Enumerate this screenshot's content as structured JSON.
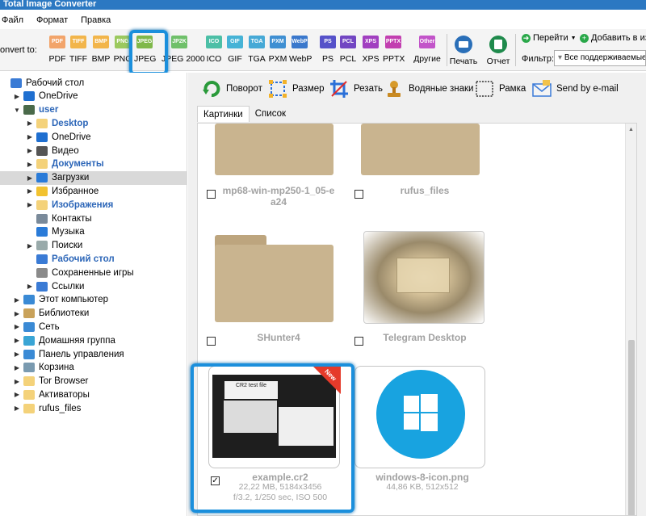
{
  "app": {
    "title": "Total Image Converter"
  },
  "menu": [
    "Файл",
    "Формат",
    "Правка"
  ],
  "toolbar": {
    "convert_label": "onvert to:",
    "formats": [
      {
        "badge": "PDF",
        "label": "PDF",
        "color": "#f2a46a"
      },
      {
        "badge": "TIFF",
        "label": "TIFF",
        "color": "#f2b54a"
      },
      {
        "badge": "BMP",
        "label": "BMP",
        "color": "#f2b54a"
      },
      {
        "badge": "PNG",
        "label": "PNG",
        "color": "#9bc95e"
      },
      {
        "badge": "JPEG",
        "label": "JPEG",
        "color": "#7fb84a"
      },
      {
        "badge": "JP2K",
        "label": "JPEG 2000",
        "color": "#6fc06a"
      },
      {
        "badge": "ICO",
        "label": "ICO",
        "color": "#4cbfa6"
      },
      {
        "badge": "GIF",
        "label": "GIF",
        "color": "#46b3d6"
      },
      {
        "badge": "TGA",
        "label": "TGA",
        "color": "#46a9d6"
      },
      {
        "badge": "PXM",
        "label": "PXM",
        "color": "#3f8fd2"
      },
      {
        "badge": "WebP",
        "label": "WebP",
        "color": "#3a78cc"
      },
      {
        "badge": "PS",
        "label": "PS",
        "color": "#5551c9"
      },
      {
        "badge": "PCL",
        "label": "PCL",
        "color": "#7246c2"
      },
      {
        "badge": "XPS",
        "label": "XPS",
        "color": "#a13fc0"
      },
      {
        "badge": "PPTX",
        "label": "PPTX",
        "color": "#c23fb0"
      },
      {
        "badge": "Other",
        "label": "Другие",
        "color": "#c254c9"
      }
    ],
    "print_label": "Печать",
    "report_label": "Отчет",
    "goto_label": "Перейти",
    "add_fav_label": "Добавить в избра",
    "filter_label": "Фильтр:",
    "filter_value": "Все поддерживаемые"
  },
  "tree": [
    {
      "label": "Рабочий стол",
      "indent": 0,
      "icon": "desktop-icon",
      "arrow": "",
      "bold": false,
      "selected": false,
      "icolor": "#3a7bd5"
    },
    {
      "label": "OneDrive",
      "indent": 1,
      "icon": "onedrive-icon",
      "arrow": "▶",
      "bold": false,
      "selected": false,
      "icolor": "#1f6fd0"
    },
    {
      "label": "user",
      "indent": 1,
      "icon": "user-icon",
      "arrow": "▼",
      "bold": true,
      "selected": false,
      "icolor": "#4a6a4a"
    },
    {
      "label": "Desktop",
      "indent": 2,
      "icon": "folder-icon",
      "arrow": "▶",
      "bold": true,
      "selected": false,
      "icolor": "#f4d27a"
    },
    {
      "label": "OneDrive",
      "indent": 2,
      "icon": "onedrive-icon",
      "arrow": "▶",
      "bold": false,
      "selected": false,
      "icolor": "#1f6fd0"
    },
    {
      "label": "Видео",
      "indent": 2,
      "icon": "video-icon",
      "arrow": "▶",
      "bold": false,
      "selected": false,
      "icolor": "#555"
    },
    {
      "label": "Документы",
      "indent": 2,
      "icon": "documents-icon",
      "arrow": "▶",
      "bold": true,
      "selected": false,
      "icolor": "#f4d27a"
    },
    {
      "label": "Загрузки",
      "indent": 2,
      "icon": "downloads-icon",
      "arrow": "▶",
      "bold": false,
      "selected": true,
      "icolor": "#2a7bd8"
    },
    {
      "label": "Избранное",
      "indent": 2,
      "icon": "star-icon",
      "arrow": "▶",
      "bold": false,
      "selected": false,
      "icolor": "#f2c230"
    },
    {
      "label": "Изображения",
      "indent": 2,
      "icon": "images-icon",
      "arrow": "▶",
      "bold": true,
      "selected": false,
      "icolor": "#f4d27a"
    },
    {
      "label": "Контакты",
      "indent": 2,
      "icon": "contacts-icon",
      "arrow": "",
      "bold": false,
      "selected": false,
      "icolor": "#7a8a9a"
    },
    {
      "label": "Музыка",
      "indent": 2,
      "icon": "music-icon",
      "arrow": "",
      "bold": false,
      "selected": false,
      "icolor": "#2a7bd8"
    },
    {
      "label": "Поиски",
      "indent": 2,
      "icon": "search-icon",
      "arrow": "▶",
      "bold": false,
      "selected": false,
      "icolor": "#9aa"
    },
    {
      "label": "Рабочий стол",
      "indent": 2,
      "icon": "desktop-icon",
      "arrow": "",
      "bold": true,
      "selected": false,
      "icolor": "#3a7bd5"
    },
    {
      "label": "Сохраненные игры",
      "indent": 2,
      "icon": "games-icon",
      "arrow": "",
      "bold": false,
      "selected": false,
      "icolor": "#8a8a8a"
    },
    {
      "label": "Ссылки",
      "indent": 2,
      "icon": "links-icon",
      "arrow": "▶",
      "bold": false,
      "selected": false,
      "icolor": "#3a7bd5"
    },
    {
      "label": "Этот компьютер",
      "indent": 1,
      "icon": "computer-icon",
      "arrow": "▶",
      "bold": false,
      "selected": false,
      "icolor": "#3a8ad5"
    },
    {
      "label": "Библиотеки",
      "indent": 1,
      "icon": "libraries-icon",
      "arrow": "▶",
      "bold": false,
      "selected": false,
      "icolor": "#c9a25a"
    },
    {
      "label": "Сеть",
      "indent": 1,
      "icon": "network-icon",
      "arrow": "▶",
      "bold": false,
      "selected": false,
      "icolor": "#3a8ad5"
    },
    {
      "label": "Домашняя группа",
      "indent": 1,
      "icon": "homegroup-icon",
      "arrow": "▶",
      "bold": false,
      "selected": false,
      "icolor": "#3aa5d5"
    },
    {
      "label": "Панель управления",
      "indent": 1,
      "icon": "control-panel-icon",
      "arrow": "▶",
      "bold": false,
      "selected": false,
      "icolor": "#3a8ad5"
    },
    {
      "label": "Корзина",
      "indent": 1,
      "icon": "recycle-bin-icon",
      "arrow": "▶",
      "bold": false,
      "selected": false,
      "icolor": "#7a9ab0"
    },
    {
      "label": "Tor Browser",
      "indent": 1,
      "icon": "folder-icon",
      "arrow": "▶",
      "bold": false,
      "selected": false,
      "icolor": "#f4d27a"
    },
    {
      "label": "Активаторы",
      "indent": 1,
      "icon": "folder-icon",
      "arrow": "▶",
      "bold": false,
      "selected": false,
      "icolor": "#f4d27a"
    },
    {
      "label": "rufus_files",
      "indent": 1,
      "icon": "folder-icon",
      "arrow": "▶",
      "bold": false,
      "selected": false,
      "icolor": "#f4d27a"
    }
  ],
  "content_toolbar": {
    "rotate": "Поворот",
    "resize": "Размер",
    "crop": "Резать",
    "watermark": "Водяные знаки",
    "frame": "Рамка",
    "email": "Send by e-mail"
  },
  "tabs": [
    "Картинки",
    "Список"
  ],
  "files": [
    {
      "name": "mp68-win-mp250-1_05-ea24",
      "line1": "mp68-win-mp250-1_05-e",
      "line2": "a24",
      "meta1": "",
      "meta2": "",
      "checked": false
    },
    {
      "name": "rufus_files",
      "line1": "rufus_files",
      "line2": "",
      "meta1": "",
      "meta2": "",
      "checked": false
    },
    {
      "name": "SHunter4",
      "line1": "SHunter4",
      "line2": "",
      "meta1": "",
      "meta2": "",
      "checked": false
    },
    {
      "name": "Telegram Desktop",
      "line1": "Telegram Desktop",
      "line2": "",
      "meta1": "",
      "meta2": "",
      "checked": false
    },
    {
      "name": "example.cr2",
      "line1": "example.cr2",
      "line2": "",
      "meta1": "22,22 MB, 5184x3456",
      "meta2": "f/3.2, 1/250 sec, ISO 500",
      "checked": true
    },
    {
      "name": "windows-8-icon.png",
      "line1": "windows-8-icon.png",
      "line2": "",
      "meta1": "44,86 KB, 512x512",
      "meta2": "",
      "checked": false
    }
  ],
  "thumb_text": {
    "cr2_label": "CR2 test file",
    "new_badge": "New"
  }
}
